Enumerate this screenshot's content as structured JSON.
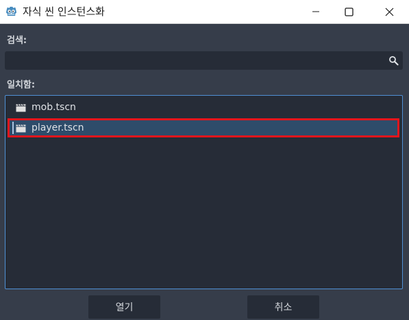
{
  "window": {
    "title": "자식 씬 인스턴스화",
    "icon": "godot-icon",
    "controls": [
      "minimize-icon",
      "maximize-icon",
      "close-icon"
    ]
  },
  "search": {
    "label": "검색:",
    "value": "",
    "icon": "search-icon"
  },
  "matches": {
    "label": "일치함:",
    "items": [
      {
        "label": "mob.tscn",
        "icon": "scene-clapperboard-icon",
        "selected": false
      },
      {
        "label": "player.tscn",
        "icon": "scene-clapperboard-icon",
        "selected": true
      }
    ]
  },
  "buttons": {
    "open_label": "열기",
    "cancel_label": "취소"
  },
  "colors": {
    "background": "#363d4a",
    "field_background": "#262c37",
    "focus_border": "#4f90d5",
    "selected_row": "#2e4c6a",
    "highlight_border": "#e5151c",
    "godot_blue": "#478cbf"
  }
}
